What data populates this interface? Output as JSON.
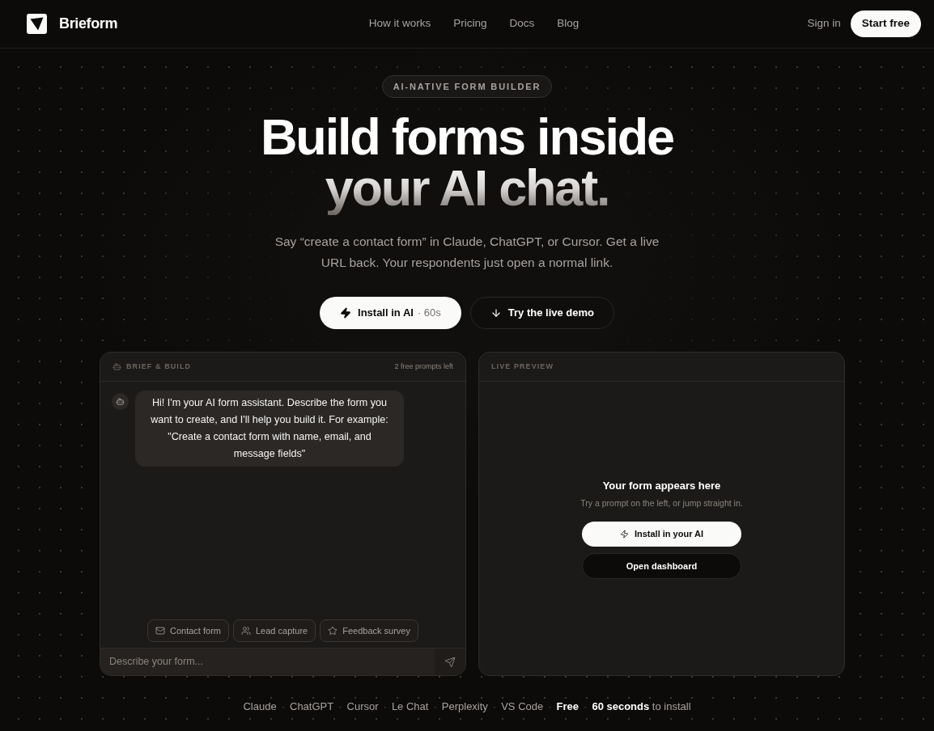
{
  "nav": {
    "brand": "Brieform",
    "links": [
      "How it works",
      "Pricing",
      "Docs",
      "Blog"
    ],
    "sign_in": "Sign in",
    "cta": "Start free"
  },
  "hero": {
    "badge": "AI-NATIVE FORM BUILDER",
    "title_lines": [
      "Build forms inside",
      "your AI chat."
    ],
    "subtitle": "Say “create a contact form” in Claude, ChatGPT, or Cursor. Get a live URL back. Your respondents just open a normal link.",
    "buttons": [
      {
        "kind": "primary",
        "label": "Install in AI",
        "note": "· 60s"
      },
      {
        "kind": "secondary",
        "label": "Try the live demo"
      }
    ]
  },
  "chat_panel": {
    "title": "BRIEF & BUILD",
    "prompts_left": "2 free prompts left",
    "messages": [
      {
        "kind": "assistant",
        "text": "Hi! I'm your AI form assistant. Describe the form you want to create, and I'll help you build it. For example: \"Create a contact form with name, email, and message fields\""
      }
    ],
    "suggestions": [
      {
        "kind": "contact",
        "label": "Contact form"
      },
      {
        "kind": "lead",
        "label": "Lead capture"
      },
      {
        "kind": "survey",
        "label": "Feedback survey"
      }
    ],
    "input": {
      "placeholder": "Describe your form..."
    }
  },
  "preview_panel": {
    "title": "LIVE PREVIEW",
    "empty_title": "Your form appears here",
    "empty_hint": "Try a prompt on the left, or jump straight in.",
    "buttons": [
      {
        "kind": "primary",
        "label": "Install in your AI"
      },
      {
        "kind": "secondary",
        "label": "Open dashboard"
      }
    ]
  },
  "footer": [
    {
      "kind": "platform",
      "text": "Claude"
    },
    {
      "kind": "separator",
      "text": "·"
    },
    {
      "kind": "platform",
      "text": "ChatGPT"
    },
    {
      "kind": "separator",
      "text": "·"
    },
    {
      "kind": "platform",
      "text": "Cursor"
    },
    {
      "kind": "separator",
      "text": "·"
    },
    {
      "kind": "platform",
      "text": "Le Chat"
    },
    {
      "kind": "separator",
      "text": "·"
    },
    {
      "kind": "platform",
      "text": "Perplexity"
    },
    {
      "kind": "separator",
      "text": "·"
    },
    {
      "kind": "platform",
      "text": "VS Code"
    },
    {
      "kind": "separator",
      "text": "·"
    },
    {
      "kind": "highlight",
      "text": "Free"
    },
    {
      "kind": "separator",
      "text": "·"
    },
    {
      "kind": "note",
      "text": "**60 seconds** to install"
    }
  ]
}
